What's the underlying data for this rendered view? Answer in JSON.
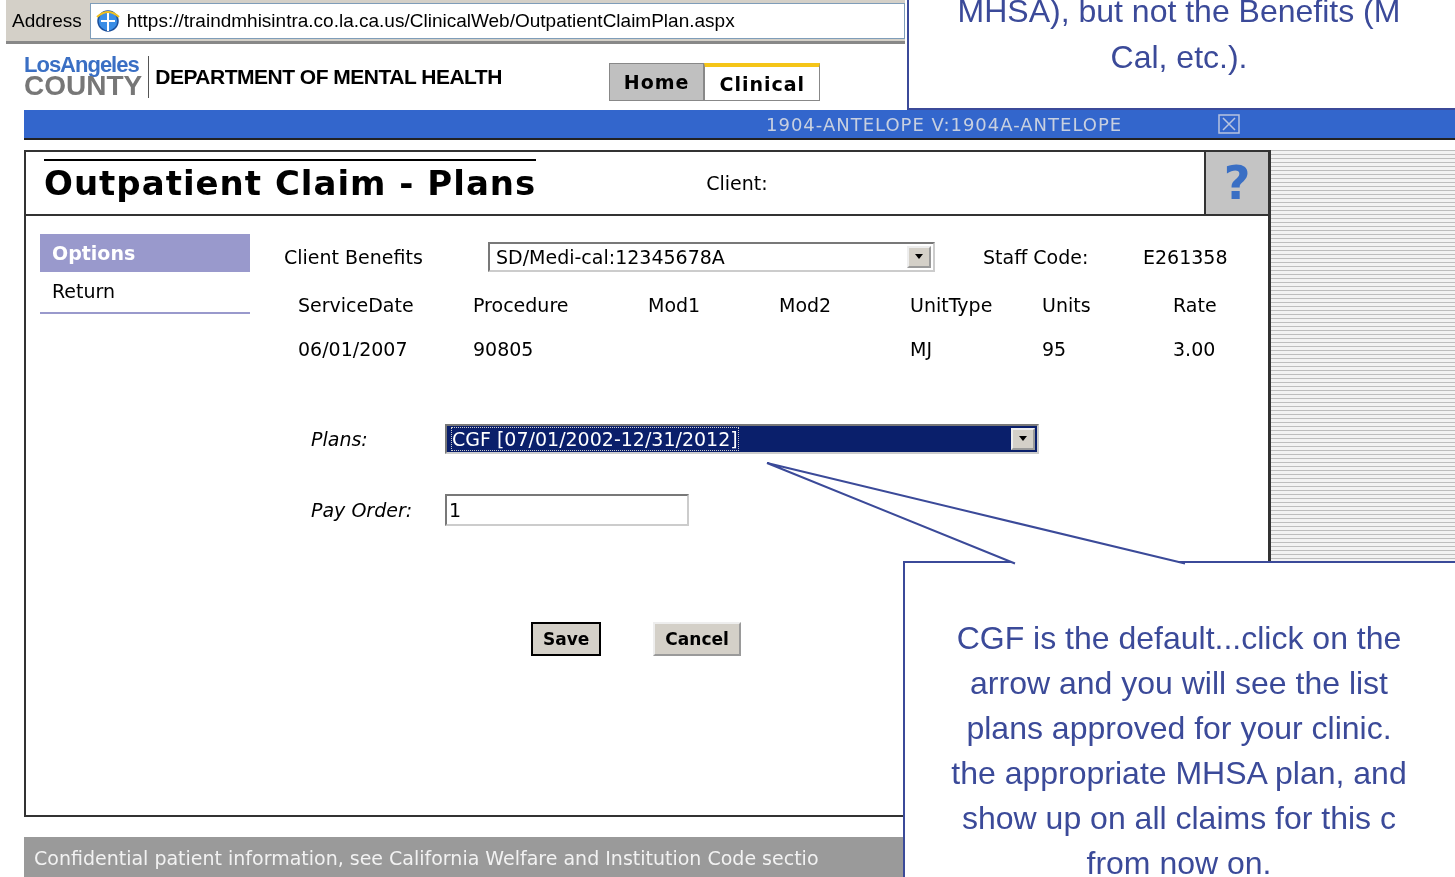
{
  "address_bar": {
    "label": "Address",
    "url": "https://traindmhisintra.co.la.ca.us/ClinicalWeb/OutpatientClaimPlan.aspx"
  },
  "header": {
    "logo_top": "LosAngeles",
    "logo_bottom": "COUNTY",
    "department": "DEPARTMENT OF MENTAL HEALTH",
    "tabs": [
      {
        "label": "Home",
        "selected": false
      },
      {
        "label": "Clinical",
        "selected": true
      }
    ]
  },
  "location_bar": {
    "text": "1904-ANTELOPE V:1904A-ANTELOPE"
  },
  "page": {
    "title": "Outpatient Claim - Plans",
    "client_label": "Client:",
    "help": "?"
  },
  "sidebar": {
    "items": [
      {
        "label": "Options",
        "selected": true
      },
      {
        "label": "Return",
        "selected": false
      }
    ]
  },
  "form": {
    "client_benefits_label": "Client Benefits",
    "client_benefits_value": "SD/Medi-cal:12345678A",
    "staff_code_label": "Staff Code:",
    "staff_code_value": "E261358"
  },
  "table": {
    "columns": [
      "ServiceDate",
      "Procedure",
      "Mod1",
      "Mod2",
      "UnitType",
      "Units",
      "Rate"
    ],
    "rows": [
      [
        "06/01/2007",
        "90805",
        null,
        null,
        "MJ",
        "95",
        "3.00"
      ]
    ]
  },
  "plans": {
    "label": "Plans:",
    "value": "CGF [07/01/2002-12/31/2012]"
  },
  "pay_order": {
    "label": "Pay Order:",
    "value": "1"
  },
  "buttons": [
    {
      "label": "Save",
      "default": true
    },
    {
      "label": "Cancel",
      "default": false
    }
  ],
  "footer": "Confidential patient information, see California Welfare and Institution Code sectio",
  "callouts": [
    {
      "lines": [
        "MHSA), but not the Benefits (M",
        "Cal, etc.)."
      ]
    },
    {
      "lines": [
        "CGF is the default...click on the",
        "arrow and you will see the list",
        "plans approved for your clinic.",
        "the appropriate MHSA plan, and",
        "show up on all claims for this c",
        "from now on."
      ]
    }
  ]
}
